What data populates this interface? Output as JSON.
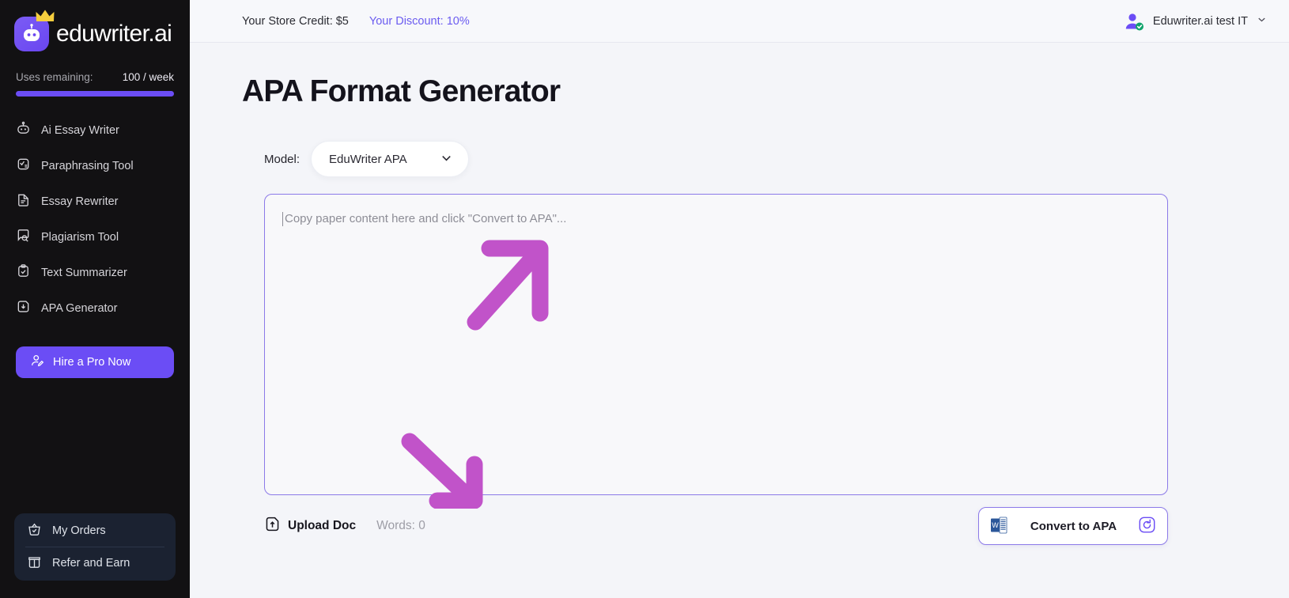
{
  "brand": {
    "name": "eduwriter.ai",
    "logo_icon": "robot-logo-icon",
    "crown_icon": "crown-icon",
    "accent_color": "#6b4df5"
  },
  "sidebar": {
    "uses": {
      "label": "Uses remaining:",
      "value": "100 / week",
      "progress_percent": 100
    },
    "items": [
      {
        "label": "Ai Essay Writer",
        "icon": "robot-icon"
      },
      {
        "label": "Paraphrasing Tool",
        "icon": "paraphrase-icon"
      },
      {
        "label": "Essay Rewriter",
        "icon": "document-lines-icon"
      },
      {
        "label": "Plagiarism Tool",
        "icon": "search-document-icon"
      },
      {
        "label": "Text Summarizer",
        "icon": "clipboard-check-icon"
      },
      {
        "label": "APA Generator",
        "icon": "download-page-icon"
      }
    ],
    "hire": {
      "label": "Hire a Pro Now",
      "icon": "user-edit-icon"
    },
    "bottom": [
      {
        "label": "My Orders",
        "icon": "basket-check-icon"
      },
      {
        "label": "Refer and Earn",
        "icon": "gift-box-icon"
      }
    ]
  },
  "topbar": {
    "store_credit": "Your Store Credit: $5",
    "discount": "Your Discount: 10%",
    "discount_color": "#6b5cf0",
    "account": {
      "name": "Eduwriter.ai test IT",
      "avatar_icon": "user-verified-avatar",
      "chevron_icon": "chevron-down-icon"
    }
  },
  "main": {
    "title": "APA Format Generator",
    "model": {
      "label": "Model:",
      "selected": "EduWriter APA",
      "chevron_icon": "chevron-down-icon"
    },
    "editor": {
      "placeholder": "Copy paper content here and click \"Convert to APA\"...",
      "value": ""
    },
    "toolbar": {
      "upload_label": "Upload Doc",
      "upload_icon": "upload-file-icon",
      "words_counter": "Words: 0",
      "convert_label": "Convert to APA",
      "convert_doc_icon": "word-doc-icon",
      "convert_refresh_icon": "refresh-circle-icon"
    },
    "annotations": [
      {
        "name": "arrow-up-right",
        "color": "#c153c9"
      },
      {
        "name": "arrow-down-right",
        "color": "#c153c9"
      }
    ]
  }
}
